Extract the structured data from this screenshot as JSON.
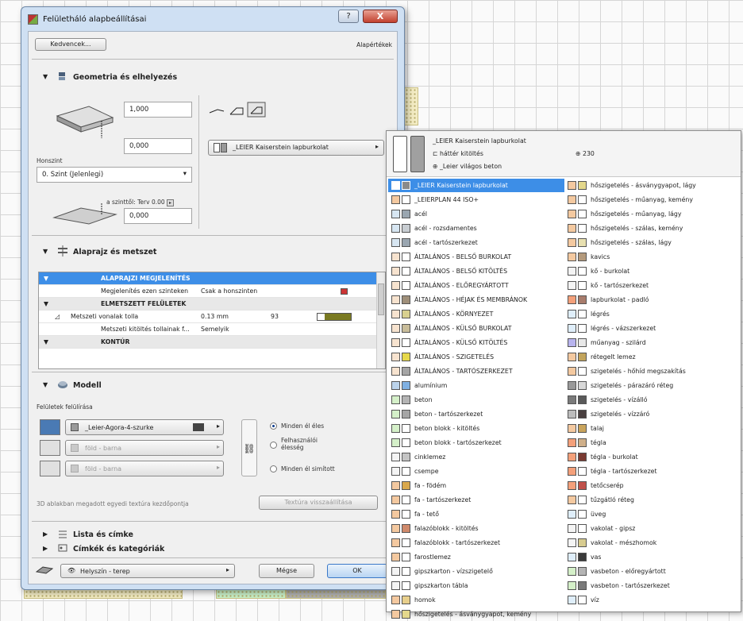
{
  "window": {
    "title": "Felületháló alapbeállításai",
    "help": "?",
    "close": "X"
  },
  "toolbar": {
    "favorites": "Kedvencek...",
    "default": "Alapértékek"
  },
  "geometry": {
    "section_title": "Geometria és elhelyezés",
    "height": "1,000",
    "offset": "0,000",
    "home_floor_label": "Honszint",
    "home_floor_value": "0. Szint (Jelenlegi)",
    "offset_label": "a szinttől: Terv 0.00",
    "offset_value": "0,000",
    "surface_material": "_LEIER Kaiserstein lapburkolat"
  },
  "plan": {
    "section_title": "Alaprajz és metszet",
    "rows": [
      {
        "type": "sel",
        "name": "ALAPRAJZI MEGJELENÍTÉS"
      },
      {
        "type": "row",
        "name": "Megjelenítés ezen szinteken",
        "value": "Csak a honszinten"
      },
      {
        "type": "hdr",
        "name": "ELMETSZETT FELÜLETEK"
      },
      {
        "type": "row",
        "name": "Metszeti vonalak tolla",
        "value": "0.13 mm",
        "num": "93"
      },
      {
        "type": "row",
        "name": "Metszeti kitöltés tollainak f...",
        "value": "Semelyik"
      },
      {
        "type": "hdr",
        "name": "KONTÚR"
      }
    ]
  },
  "model": {
    "section_title": "Modell",
    "override_label": "Felületek felülírása",
    "surfaces": [
      "_Leier-Agora-4-szurke",
      "föld - barna",
      "föld - barna"
    ],
    "options": [
      "Minden él éles",
      "Felhasználói élesség",
      "Minden él simított"
    ],
    "texture_origin_label": "3D ablakban megadott egyedi textúra kezdőpontja",
    "texture_reset": "Textúra visszaállítása"
  },
  "collapsed": [
    "Lista és címke",
    "Címkék és kategóriák"
  ],
  "footer": {
    "site": "Helyszín - terep",
    "cancel": "Mégse",
    "ok": "OK"
  },
  "popup": {
    "header": {
      "name": "_LEIER Kaiserstein lapburkolat",
      "fill": "háttér kitöltés",
      "surface": "_Leier világos beton",
      "pen": "230"
    },
    "left": [
      {
        "label": "_LEIER Kaiserstein lapburkolat",
        "c": "#ffffff",
        "d": "#8a8a8a"
      },
      {
        "label": "_LEIERPLAN 44 ISO+",
        "c": "#f4c9a0",
        "d": "#ffffff"
      },
      {
        "label": "acél",
        "c": "#d7e6f2",
        "d": "#9aa6b0"
      },
      {
        "label": "acél - rozsdamentes",
        "c": "#d7e6f2",
        "d": "#c8cdd2"
      },
      {
        "label": "acél - tartószerkezet",
        "c": "#d7e6f2",
        "d": "#9aa6b0"
      },
      {
        "label": "ÁLTALÁNOS - BELSŐ BURKOLAT",
        "c": "#f7e3cf",
        "d": "#ffffff"
      },
      {
        "label": "ÁLTALÁNOS - BELSŐ KITÖLTÉS",
        "c": "#f7e3cf",
        "d": "#ffffff"
      },
      {
        "label": "ÁLTALÁNOS - ELŐREGYÁRTOTT",
        "c": "#f7e3cf",
        "d": "#ffffff"
      },
      {
        "label": "ÁLTALÁNOS - HÉJAK ÉS MEMBRÁNOK",
        "c": "#f7e3cf",
        "d": "#9f8f7a"
      },
      {
        "label": "ÁLTALÁNOS - KÖRNYEZET",
        "c": "#f7e3cf",
        "d": "#d8d08f"
      },
      {
        "label": "ÁLTALÁNOS - KÜLSŐ BURKOLAT",
        "c": "#f7e3cf",
        "d": "#c9bd9a"
      },
      {
        "label": "ÁLTALÁNOS - KÜLSŐ KITÖLTÉS",
        "c": "#f7e3cf",
        "d": "#ffffff"
      },
      {
        "label": "ÁLTALÁNOS - SZIGETELÉS",
        "c": "#f7e3cf",
        "d": "#e6d84a"
      },
      {
        "label": "ÁLTALÁNOS - TARTÓSZERKEZET",
        "c": "#f7e3cf",
        "d": "#a5a5a5"
      },
      {
        "label": "alumínium",
        "c": "#bcd4ec",
        "d": "#7fb0e2"
      },
      {
        "label": "beton",
        "c": "#d5f0c9",
        "d": "#b4b4b4"
      },
      {
        "label": "beton - tartószerkezet",
        "c": "#d5f0c9",
        "d": "#a5a5a5"
      },
      {
        "label": "beton blokk - kitöltés",
        "c": "#d5f0c9",
        "d": "#ffffff"
      },
      {
        "label": "beton blokk - tartószerkezet",
        "c": "#d5f0c9",
        "d": "#ffffff"
      },
      {
        "label": "cinklemez",
        "c": "#f4f4f4",
        "d": "#c4c4c4"
      },
      {
        "label": "csempe",
        "c": "#f4f4f4",
        "d": "#ffffff"
      },
      {
        "label": "fa - födém",
        "c": "#f4c9a0",
        "d": "#d9a84c"
      },
      {
        "label": "fa - tartószerkezet",
        "c": "#f4c9a0",
        "d": "#ffffff"
      },
      {
        "label": "fa - tető",
        "c": "#f4c9a0",
        "d": "#ffffff"
      },
      {
        "label": "falazóblokk - kitöltés",
        "c": "#f4c9a0",
        "d": "#d08a6b"
      },
      {
        "label": "falazóblokk - tartószerkezet",
        "c": "#f4c9a0",
        "d": "#ffffff"
      },
      {
        "label": "farostlemez",
        "c": "#f4c9a0",
        "d": "#ffffff"
      },
      {
        "label": "gipszkarton - vízszigetelő",
        "c": "#f4f4f4",
        "d": "#ffffff"
      },
      {
        "label": "gipszkarton tábla",
        "c": "#f4f4f4",
        "d": "#ffffff"
      },
      {
        "label": "homok",
        "c": "#f4c9a0",
        "d": "#e8cf8c"
      },
      {
        "label": "hőszigetelés - ásványgyapot, kemény",
        "c": "#f4c9a0",
        "d": "#e4d88c"
      }
    ],
    "right": [
      {
        "label": "hőszigetelés - ásványgyapot, lágy",
        "c": "#f4c9a0",
        "d": "#e4d88c"
      },
      {
        "label": "hőszigetelés - műanyag, kemény",
        "c": "#f4c9a0",
        "d": "#ffffff"
      },
      {
        "label": "hőszigetelés - műanyag, lágy",
        "c": "#f4c9a0",
        "d": "#ffffff"
      },
      {
        "label": "hőszigetelés - szálas, kemény",
        "c": "#f4c9a0",
        "d": "#ffffff"
      },
      {
        "label": "hőszigetelés - szálas, lágy",
        "c": "#f4c9a0",
        "d": "#e8e0b0"
      },
      {
        "label": "kavics",
        "c": "#f4c9a0",
        "d": "#b49a7c"
      },
      {
        "label": "kő - burkolat",
        "c": "#f4f4f4",
        "d": "#ffffff"
      },
      {
        "label": "kő - tartószerkezet",
        "c": "#f4f4f4",
        "d": "#ffffff"
      },
      {
        "label": "lapburkolat - padló",
        "c": "#f4a07a",
        "d": "#a87c6c"
      },
      {
        "label": "légrés",
        "c": "#dfeefa",
        "d": "#ffffff"
      },
      {
        "label": "légrés - vázszerkezet",
        "c": "#dfeefa",
        "d": "#ffffff"
      },
      {
        "label": "műanyag - szilárd",
        "c": "#b8b4ee",
        "d": "#e8e8e8"
      },
      {
        "label": "rétegelt lemez",
        "c": "#f4c9a0",
        "d": "#c2a45c"
      },
      {
        "label": "szigetelés - hőhíd megszakítás",
        "c": "#f4c9a0",
        "d": "#ffffff"
      },
      {
        "label": "szigetelés - párazáró réteg",
        "c": "#9a9a9a",
        "d": "#d8d8d8"
      },
      {
        "label": "szigetelés - vízálló",
        "c": "#7a7a7a",
        "d": "#5a5a5a"
      },
      {
        "label": "szigetelés - vízzáró",
        "c": "#bcbcbc",
        "d": "#4a4040"
      },
      {
        "label": "talaj",
        "c": "#f4c9a0",
        "d": "#c9a45c"
      },
      {
        "label": "tégla",
        "c": "#f4a07a",
        "d": "#d0b08a"
      },
      {
        "label": "tégla - burkolat",
        "c": "#f4a07a",
        "d": "#7a3a32"
      },
      {
        "label": "tégla - tartószerkezet",
        "c": "#f4a07a",
        "d": "#ffffff"
      },
      {
        "label": "tetőcserép",
        "c": "#f4a07a",
        "d": "#c0504a"
      },
      {
        "label": "tűzgátló réteg",
        "c": "#f4c9a0",
        "d": "#ffffff"
      },
      {
        "label": "üveg",
        "c": "#dfeefa",
        "d": "#ffffff"
      },
      {
        "label": "vakolat - gipsz",
        "c": "#f4f4f4",
        "d": "#ffffff"
      },
      {
        "label": "vakolat - mészhomok",
        "c": "#f4f4f4",
        "d": "#d8cc90"
      },
      {
        "label": "vas",
        "c": "#dfeefa",
        "d": "#3a3a3a"
      },
      {
        "label": "vasbeton - előregyártott",
        "c": "#d5f0c9",
        "d": "#b4b4b4"
      },
      {
        "label": "vasbeton - tartószerkezet",
        "c": "#d5f0c9",
        "d": "#7a7a7a"
      },
      {
        "label": "víz",
        "c": "#dfeefa",
        "d": "#ffffff"
      }
    ]
  }
}
